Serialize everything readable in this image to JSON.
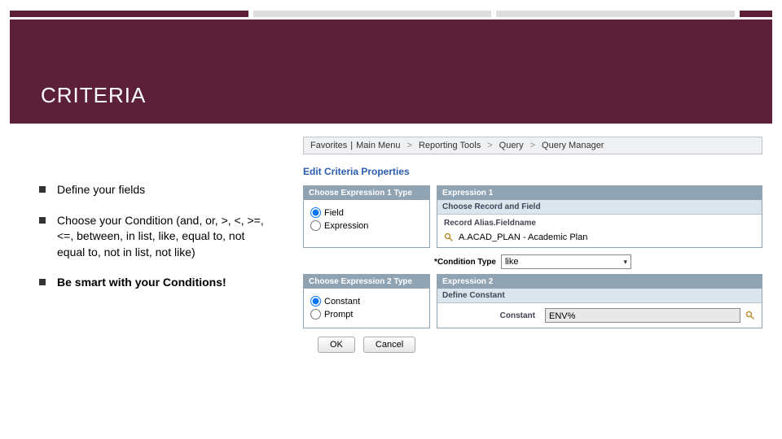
{
  "title": "CRITERIA",
  "bullets": [
    {
      "text": "Define your fields",
      "bold": false
    },
    {
      "text": "Choose your  Condition   (and, or, >, <, >=, <=, between, in list, like, equal to, not equal to, not in list, not like)",
      "bold": false
    },
    {
      "text": "Be smart with your Conditions!",
      "bold": true
    }
  ],
  "nav": {
    "favorites": "Favorites",
    "main_menu": "Main Menu",
    "reporting": "Reporting Tools",
    "query": "Query",
    "manager": "Query Manager",
    "sep": ">"
  },
  "screen": {
    "heading": "Edit Criteria Properties",
    "expr1_type_head": "Choose Expression 1 Type",
    "expr1_head": "Expression 1",
    "expr1_sub": "Choose Record and Field",
    "field_label": "Record Alias.Fieldname",
    "field_value": "A.ACAD_PLAN - Academic Plan",
    "radio_field": "Field",
    "radio_expression": "Expression",
    "condition_label": "Condition Type",
    "condition_value": "like",
    "expr2_type_head": "Choose Expression 2 Type",
    "expr2_head": "Expression 2",
    "expr2_sub": "Define Constant",
    "radio_constant": "Constant",
    "radio_prompt": "Prompt",
    "constant_label": "Constant",
    "constant_value": "ENV%",
    "ok": "OK",
    "cancel": "Cancel"
  }
}
